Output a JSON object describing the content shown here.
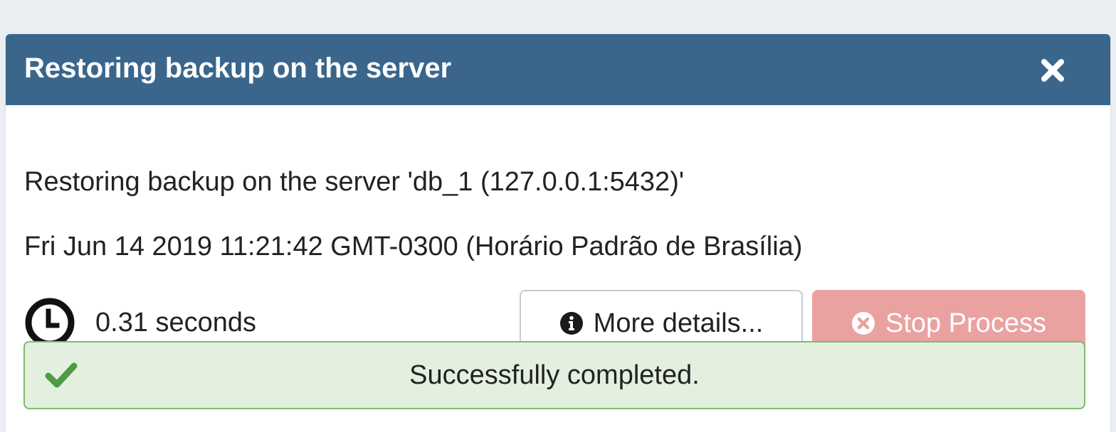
{
  "dialog": {
    "title": "Restoring backup on the server",
    "close_icon": "close-icon"
  },
  "process": {
    "description": "Restoring backup on the server 'db_1 (127.0.0.1:5432)'",
    "start_time": "Fri Jun 14 2019 11:21:42 GMT-0300 (Horário Padrão de Brasília)",
    "elapsed": "0.31 seconds",
    "elapsed_icon": "clock-icon"
  },
  "buttons": {
    "more_details_label": "More details...",
    "more_details_icon": "info-circle-icon",
    "stop_label": "Stop Process",
    "stop_icon": "times-circle-icon",
    "stop_disabled": true
  },
  "status": {
    "message": "Successfully completed.",
    "icon": "check-icon",
    "state": "success"
  },
  "colors": {
    "header": "#3a668c",
    "stop_button": "#eaa2a1",
    "success_bg": "#e3f0df",
    "success_border": "#7cbc6e",
    "success_check": "#4f9a45"
  }
}
